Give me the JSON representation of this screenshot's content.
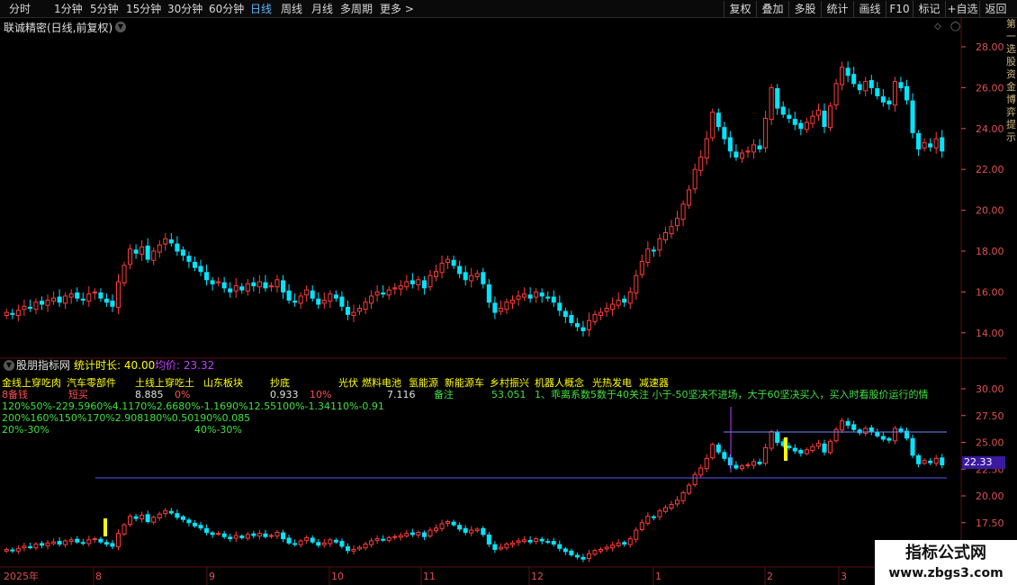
{
  "periods": [
    "分时",
    "1分钟",
    "5分钟",
    "15分钟",
    "30分钟",
    "60分钟",
    "日线",
    "周线",
    "月线",
    "多周期",
    "更多 >"
  ],
  "active_period": "日线",
  "toolbar": [
    "复权",
    "叠加",
    "多股",
    "统计",
    "画线",
    "F10",
    "标记",
    "+自选",
    "返回"
  ],
  "stock_title": "联诚精密(日线,前复权)",
  "y_axis_main": [
    "28.00",
    "26.00",
    "24.00",
    "22.00",
    "20.00",
    "18.00",
    "16.00",
    "14.00"
  ],
  "y_axis_sub": [
    "30.00",
    "27.50",
    "25.00",
    "22.50",
    "20.00",
    "17.50",
    "15.00"
  ],
  "x_axis": [
    "2025年",
    "8",
    "9",
    "10",
    "11",
    "12",
    "1",
    "2",
    "3"
  ],
  "sub_header": {
    "name": "股朋指标网",
    "duration_label": "统计时长: 40.00",
    "avg_label": "均价: 23.32"
  },
  "overlay": {
    "row1": [
      "金线上穿吃肉",
      "汽车零部件",
      "土线上穿吃土",
      "山东板块",
      "抄底",
      "光伏",
      "燃料电池",
      "氢能源",
      "新能源车",
      "乡村振兴",
      "机器人概念",
      "光热发电",
      "减速器"
    ],
    "row2_a": "8备钱",
    "row2_b": "短买",
    "row2_c": "8.885",
    "row2_d": "0%",
    "row2_e": "0.933",
    "row2_f": "10%",
    "row2_g": "7.116",
    "row2_h": "备注",
    "row2_i": "53.051",
    "row2_j": "1、乖离系数5数于40关注 小于-50坚决不进场，大于60坚决买入，买入时看股价运行的情",
    "row3": "120%50%-229.5960%4.1170%2.6680%-1.1690%12.55100%-1.34110%-0.91",
    "row4": "200%160%150%170%2.908180%0.50190%0.085",
    "row5_a": "20%-30%",
    "row5_b": "40%-30%"
  },
  "price_tag": "22.33",
  "watermark": {
    "title": "指标公式网",
    "url": "www.zbgs3.com"
  },
  "right_strip": "第一选股资金博弈提示",
  "colors": {
    "up": "#ff3b3b",
    "down": "#00e5ff",
    "grid": "#5a1010",
    "axis_text": "#e05050",
    "yellow": "#ffff00",
    "level_line": "#5a5aff",
    "purple": "#c040ff"
  },
  "chart_data": {
    "type": "candlestick",
    "series": [
      {
        "values": [
          15.0,
          14.9,
          15.1,
          15.3,
          15.2,
          15.5,
          15.4,
          15.6,
          15.7,
          15.5,
          15.8,
          15.9,
          15.7,
          15.6,
          15.9,
          16.0,
          15.7,
          15.5,
          15.3,
          16.5,
          17.3,
          18.1,
          17.9,
          18.2,
          17.6,
          18.0,
          18.3,
          18.6,
          18.4,
          18.0,
          17.8,
          17.5,
          17.2,
          17.0,
          16.6,
          16.4,
          16.5,
          16.2,
          16.0,
          16.3,
          16.1,
          16.4,
          16.3,
          16.5,
          16.2,
          16.3,
          16.6,
          16.0,
          15.6,
          15.5,
          15.8,
          16.1,
          15.7,
          15.4,
          15.6,
          15.9,
          15.7,
          15.3,
          14.9,
          15.0,
          15.2,
          15.5,
          15.8,
          16.0,
          15.9,
          16.1,
          16.2,
          16.3,
          16.5,
          16.4,
          16.6,
          16.2,
          16.8,
          17.0,
          17.4,
          17.6,
          17.3,
          16.9,
          16.6,
          16.8,
          16.9,
          16.4,
          15.5,
          15.0,
          15.2,
          15.5,
          15.6,
          15.8,
          15.9,
          15.7,
          16.0,
          15.8,
          15.7,
          15.5,
          15.1,
          14.8,
          14.5,
          14.3,
          14.1,
          14.6,
          14.9,
          15.0,
          15.2,
          15.4,
          15.6,
          15.5,
          16.0,
          16.8,
          17.5,
          18.1,
          18.0,
          18.6,
          18.9,
          19.2,
          19.6,
          20.3,
          21.0,
          22.0,
          22.6,
          23.5,
          24.8,
          24.1,
          23.5,
          22.9,
          22.6,
          22.8,
          22.9,
          23.2,
          23.0,
          24.5,
          26.0,
          25.0,
          24.7,
          24.5,
          24.2,
          24.0,
          24.3,
          24.6,
          24.9,
          24.1,
          25.1,
          26.2,
          27.0,
          26.6,
          26.2,
          25.9,
          26.3,
          26.0,
          25.6,
          25.3,
          25.2,
          26.3,
          26.0,
          25.4,
          23.8,
          23.0,
          23.3,
          23.1,
          23.5,
          22.9
        ]
      }
    ]
  }
}
